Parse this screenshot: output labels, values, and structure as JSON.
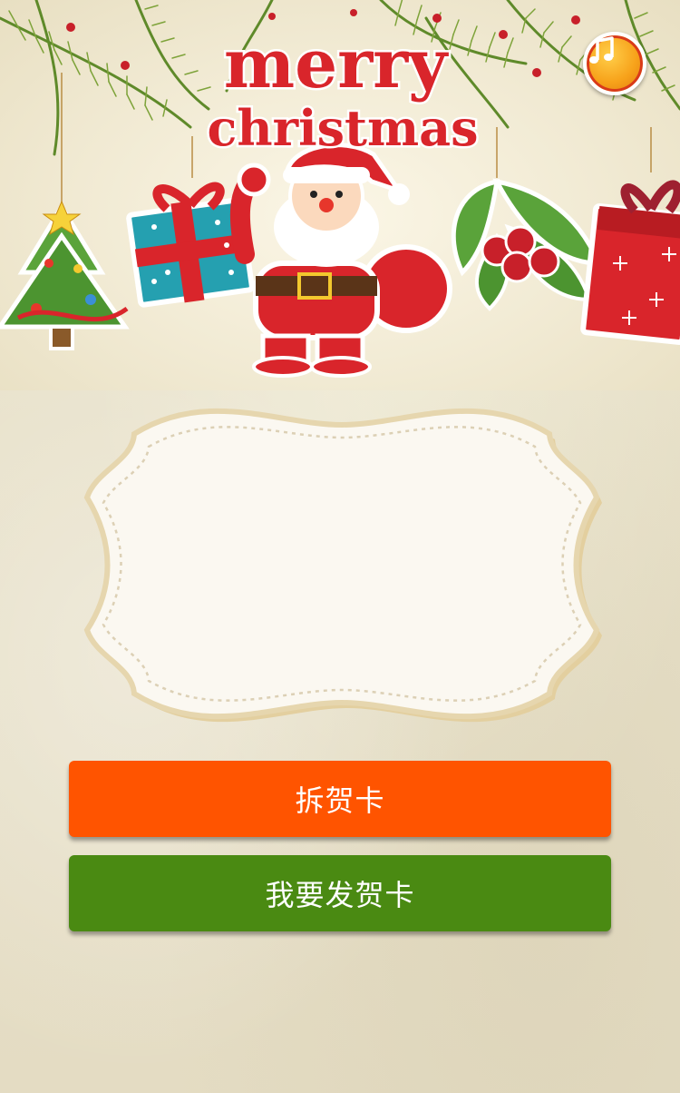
{
  "banner": {
    "greeting_line1": "merry",
    "greeting_line2": "christmas"
  },
  "music": {
    "icon": "music-note-icon"
  },
  "actions": {
    "open_card": "拆贺卡",
    "send_card": "我要发贺卡"
  },
  "colors": {
    "open_button": "#ff5400",
    "send_button": "#4a8a12",
    "title_red": "#d9252b",
    "music_orange": "#f7a21a"
  }
}
